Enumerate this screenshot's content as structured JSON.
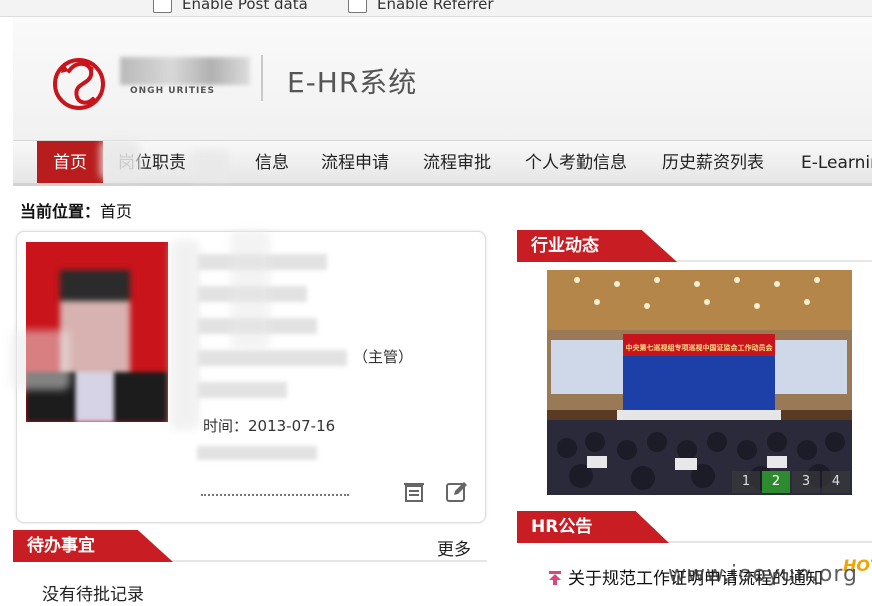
{
  "extension_bar": {
    "options": [
      "Enable Post data",
      "Enable Referrer"
    ]
  },
  "header": {
    "company_en": "ONGH   URITIES",
    "system_name": "E-HR系统"
  },
  "nav": {
    "items": [
      "首页",
      "岗位职责",
      "信息",
      "流程申请",
      "流程审批",
      "个人考勤信息",
      "历史薪资列表",
      "E-Learnin"
    ]
  },
  "breadcrumb": {
    "label": "当前位置：",
    "value": "首页"
  },
  "profile": {
    "partial_1": "（主管）",
    "partial_2": "时间：2013-07-16"
  },
  "todo": {
    "title": "待办事宜",
    "more": "更多",
    "empty": "没有待批记录"
  },
  "industry_news": {
    "title": "行业动态",
    "pager": [
      "1",
      "2",
      "3",
      "4"
    ],
    "active_page": "2",
    "banner_text": "中央第七巡视组专项巡视中国证监会工作动员会"
  },
  "hr_notice": {
    "title": "HR公告",
    "items": [
      "关于规范工作证明申请流程的通知"
    ]
  },
  "watermark": "www.iooyun.org",
  "hot_label": "HOT",
  "colors": {
    "accent_red": "#c81d22",
    "nav_active": "#b81c1c"
  }
}
